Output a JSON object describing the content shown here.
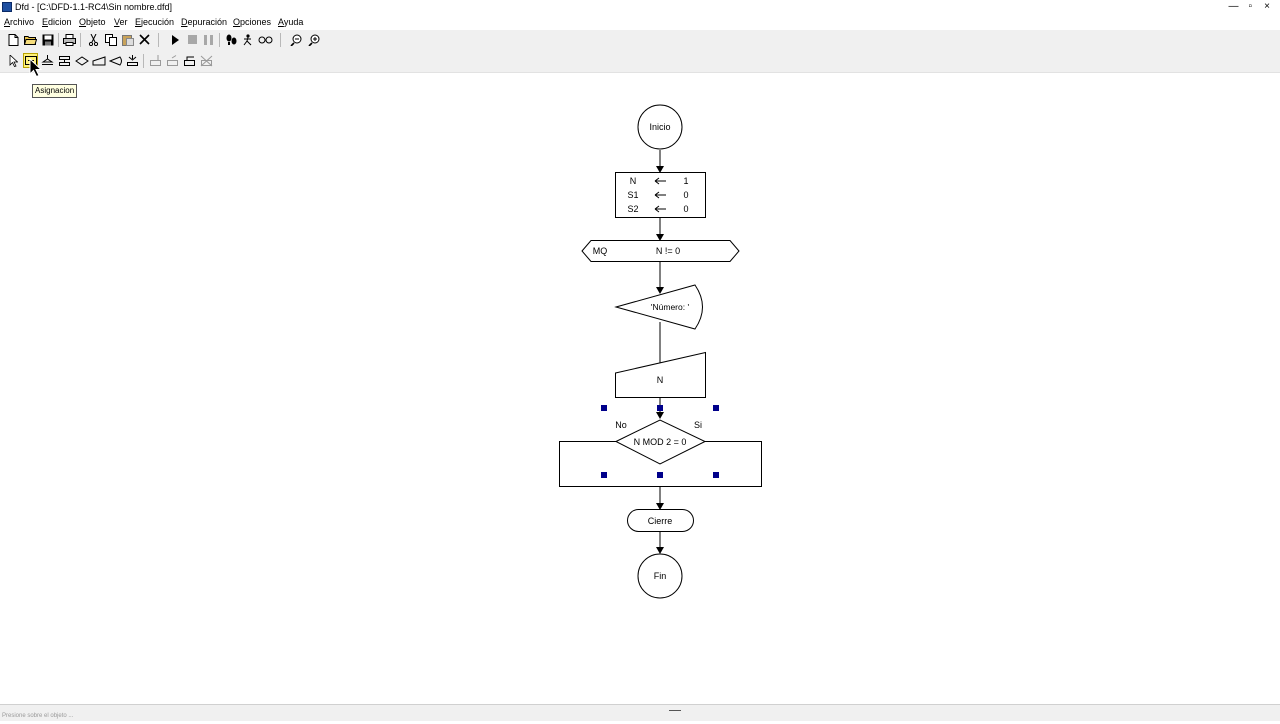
{
  "window": {
    "title": "Dfd - [C:\\DFD-1.1-RC4\\Sin nombre.dfd]",
    "controls": [
      "—",
      "▫",
      "×"
    ]
  },
  "menu": {
    "items": [
      "Archivo",
      "Edicion",
      "Objeto",
      "Ver",
      "Ejecución",
      "Depuración",
      "Opciones",
      "Ayuda"
    ]
  },
  "toolbar1": {
    "buttons": [
      "new-file-icon",
      "open-folder-icon",
      "save-icon",
      "print-icon",
      "cut-icon",
      "copy-icon",
      "paste-icon",
      "delete-icon",
      "run-icon",
      "stop-icon",
      "pause-icon",
      "step-icon",
      "step-run-icon",
      "watch-icon",
      "zoom-out-icon",
      "zoom-in-icon"
    ]
  },
  "toolbar2": {
    "buttons": [
      "pointer-icon",
      "assignment-icon",
      "loop-icon",
      "cycle-icon",
      "decision-icon",
      "read-icon",
      "write-icon",
      "subroutine-icon",
      "for-icon",
      "end-icon",
      "return-icon",
      "erase-icon"
    ],
    "active": "assignment-icon"
  },
  "tooltip": {
    "text": "Asignacion"
  },
  "flowchart": {
    "start": "Inicio",
    "assignment": {
      "rows": [
        {
          "var": "N",
          "value": "1"
        },
        {
          "var": "S1",
          "value": "0"
        },
        {
          "var": "S2",
          "value": "0"
        }
      ]
    },
    "while": {
      "label": "MQ",
      "condition": "N != 0"
    },
    "output": "'Número: '",
    "input": "N",
    "decision": {
      "condition": "N MOD 2 = 0",
      "no_label": "No",
      "yes_label": "Si"
    },
    "loop_close": "Cierre",
    "end": "Fin"
  },
  "status": {
    "text": "Presione sobre el objeto ..."
  },
  "colors": {
    "selection": "#00008b",
    "tooltip_bg": "#ffffe1",
    "highlight": "#fff27a"
  }
}
